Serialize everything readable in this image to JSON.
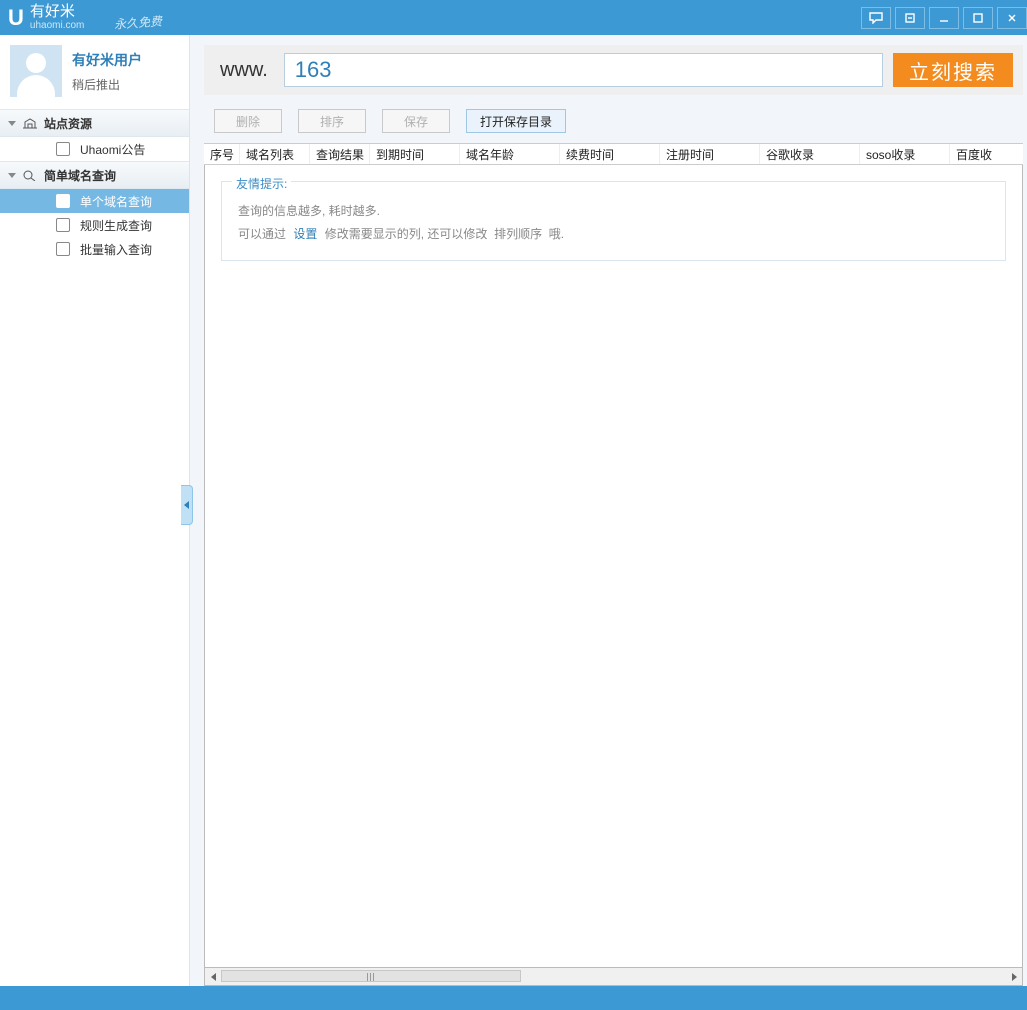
{
  "titlebar": {
    "logo_letter": "U",
    "app_name": "有好米",
    "app_domain": "uhaomi.com",
    "free_badge": "永久免费"
  },
  "user": {
    "name": "有好米用户",
    "sub": "稍后推出"
  },
  "sidebar": {
    "group1": {
      "title": "站点资源",
      "items": [
        {
          "label": "Uhaomi公告"
        }
      ]
    },
    "group2": {
      "title": "简单域名查询",
      "items": [
        {
          "label": "单个域名查询",
          "active": true
        },
        {
          "label": "规则生成查询"
        },
        {
          "label": "批量输入查询"
        }
      ]
    }
  },
  "search": {
    "prefix": "www.",
    "value": "163",
    "button": "立刻搜索"
  },
  "toolbar": {
    "delete": "删除",
    "sort": "排序",
    "save": "保存",
    "open_dir": "打开保存目录"
  },
  "columns": [
    "序号",
    "域名列表",
    "查询结果",
    "到期时间",
    "域名年龄",
    "续费时间",
    "注册时间",
    "谷歌收录",
    "soso收录",
    "百度收"
  ],
  "tip": {
    "legend": "友情提示:",
    "line1": "查询的信息越多, 耗时越多.",
    "line2a": "可以通过",
    "link": "设置",
    "line2b": "修改需要显示的列, 还可以修改",
    "line2c": "排列顺序",
    "line2d": "哦."
  }
}
